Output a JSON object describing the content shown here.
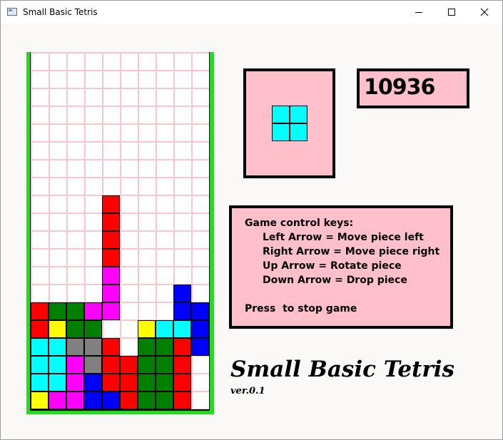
{
  "window": {
    "title": "Small Basic Tetris",
    "controls": [
      "minimize-icon",
      "maximize-icon",
      "close-icon"
    ]
  },
  "colors": {
    "R": "#ff0000",
    "M": "#ff00ff",
    "G": "#007f00",
    "Y": "#ffff00",
    "C": "#00ffff",
    "B": "#0000ff",
    "g": "#808080",
    "field_border": "#22dd22",
    "panel_background": "#ffc0cb",
    "grid_lines": "#f6c7cf"
  },
  "board": {
    "columns": 10,
    "rows": 20,
    "cells": [
      "..........",
      "..........",
      "..........",
      "..........",
      "..........",
      "..........",
      "..........",
      "..........",
      "....R.....",
      "....R.....",
      "....R.....",
      "....R.....",
      "....M.....",
      "....M...B.",
      "RGGMM...BB",
      "RYGG..YCCB",
      "CCggR.GGRB",
      "CCMgRRGGR.",
      "CCMBRRGGR.",
      "YMMBBRGGR."
    ]
  },
  "next_piece": {
    "label": "next-piece-preview",
    "color": "C",
    "cells": [
      [
        0,
        0
      ],
      [
        1,
        0
      ],
      [
        0,
        1
      ],
      [
        1,
        1
      ]
    ]
  },
  "score": "10936",
  "help": {
    "heading": "Game control keys:",
    "lines": [
      "Left Arrow = Move piece left",
      "Right Arrow = Move piece right",
      "Up Arrow = Rotate piece",
      "Down Arrow = Drop piece"
    ],
    "stop_text": "Press  to stop game"
  },
  "branding": {
    "title": "Small Basic Tetris",
    "version": "ver.0.1"
  }
}
